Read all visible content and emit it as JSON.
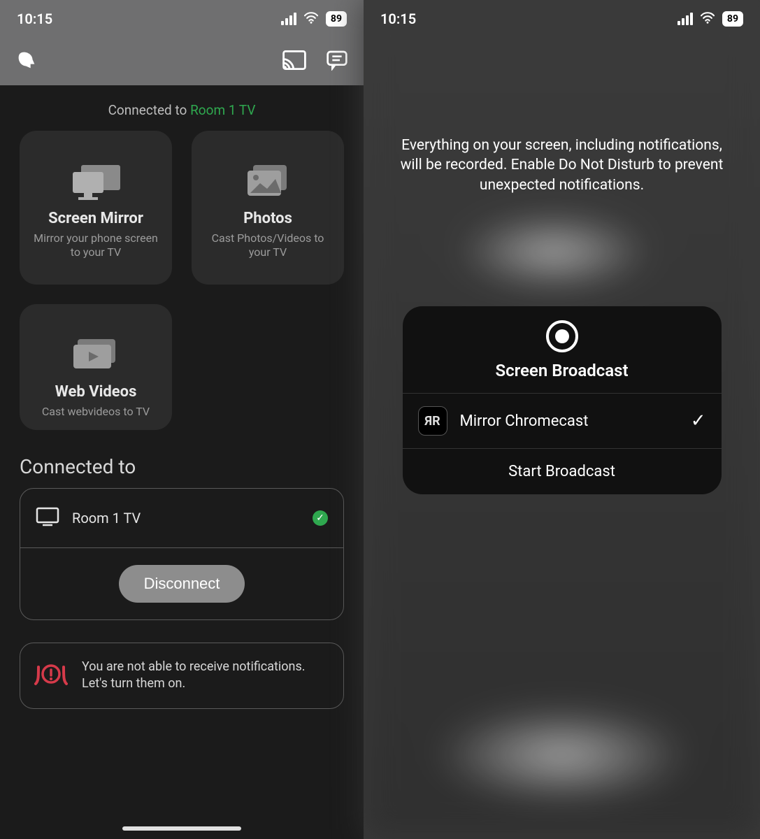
{
  "status": {
    "time": "10:15",
    "battery": "89"
  },
  "left": {
    "connected_prefix": "Connected to ",
    "connected_device": "Room 1 TV",
    "tiles": [
      {
        "title": "Screen Mirror",
        "subtitle": "Mirror your phone screen to your TV"
      },
      {
        "title": "Photos",
        "subtitle": "Cast Photos/Videos to your TV"
      },
      {
        "title": "Web Videos",
        "subtitle": "Cast webvideos to TV"
      }
    ],
    "section_title": "Connected to",
    "device": {
      "name": "Room 1 TV"
    },
    "disconnect_label": "Disconnect",
    "alert": "You are not able to receive notifications. Let's turn them on."
  },
  "right": {
    "message": "Everything on your screen, including notifications, will be recorded. Enable Do Not Disturb to prevent unexpected notifications.",
    "sheet": {
      "title": "Screen Broadcast",
      "app_icon_text": "ЯR",
      "app_name": "Mirror Chromecast",
      "start_label": "Start Broadcast"
    }
  }
}
